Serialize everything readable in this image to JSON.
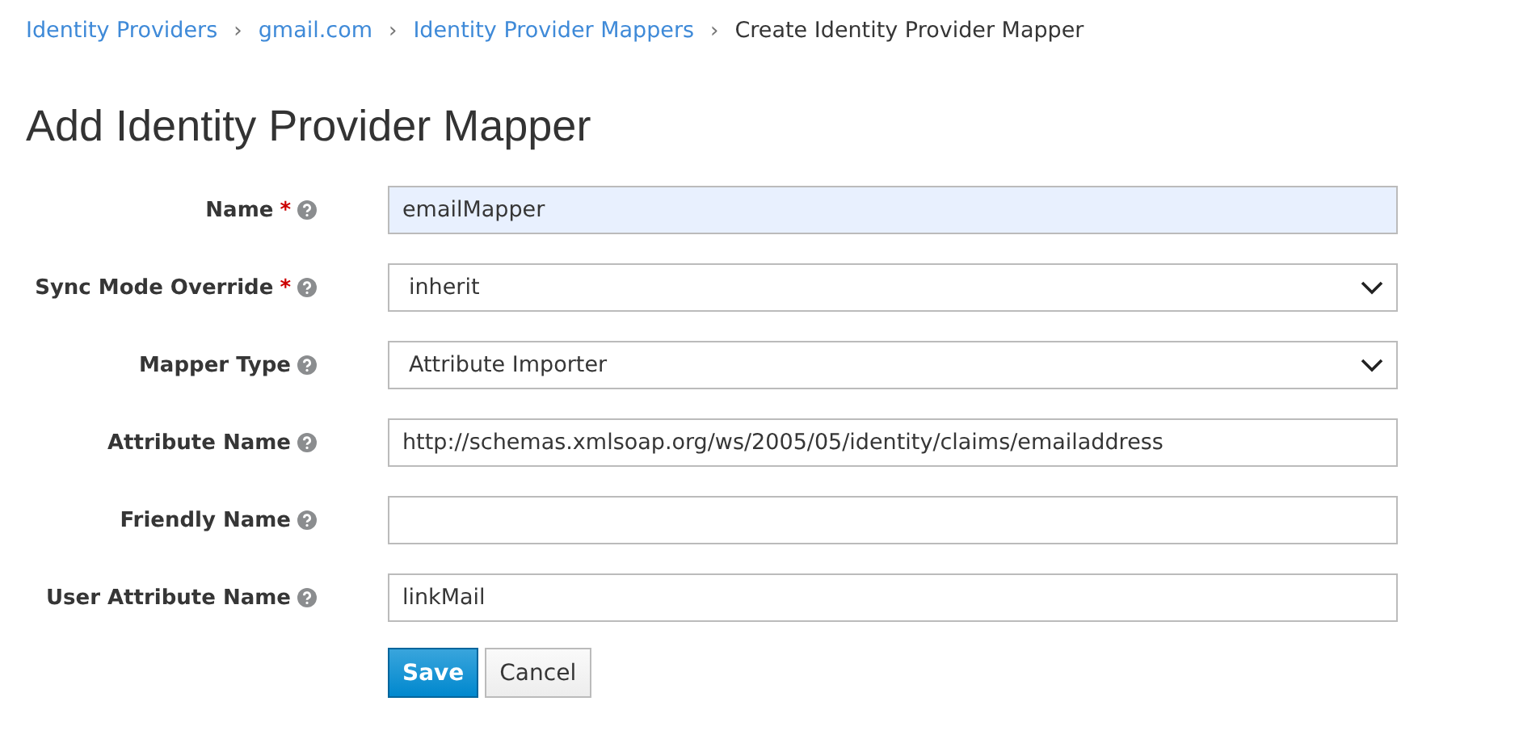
{
  "breadcrumb_separator": "›",
  "breadcrumb": [
    {
      "label": "Identity Providers",
      "kind": "link"
    },
    {
      "label": "gmail.com",
      "kind": "link"
    },
    {
      "label": "Identity Provider Mappers",
      "kind": "link"
    },
    {
      "label": "Create Identity Provider Mapper",
      "kind": "current"
    }
  ],
  "title": "Add Identity Provider Mapper",
  "fields": [
    {
      "label": "Name",
      "required": true,
      "kind": "text",
      "value": "emailMapper",
      "autofilled": true
    },
    {
      "label": "Sync Mode Override",
      "required": true,
      "kind": "select",
      "value": "inherit"
    },
    {
      "label": "Mapper Type",
      "required": false,
      "kind": "select",
      "value": "Attribute Importer"
    },
    {
      "label": "Attribute Name",
      "required": false,
      "kind": "text",
      "value": "http://schemas.xmlsoap.org/ws/2005/05/identity/claims/emailaddress",
      "autofilled": false
    },
    {
      "label": "Friendly Name",
      "required": false,
      "kind": "text",
      "autofilled": false
    },
    {
      "label": "User Attribute Name",
      "required": false,
      "kind": "text",
      "value": "linkMail",
      "autofilled": false
    }
  ],
  "required_mark": "*",
  "buttons": [
    {
      "label": "Save",
      "kind": "primary"
    },
    {
      "label": "Cancel",
      "kind": "default"
    }
  ]
}
